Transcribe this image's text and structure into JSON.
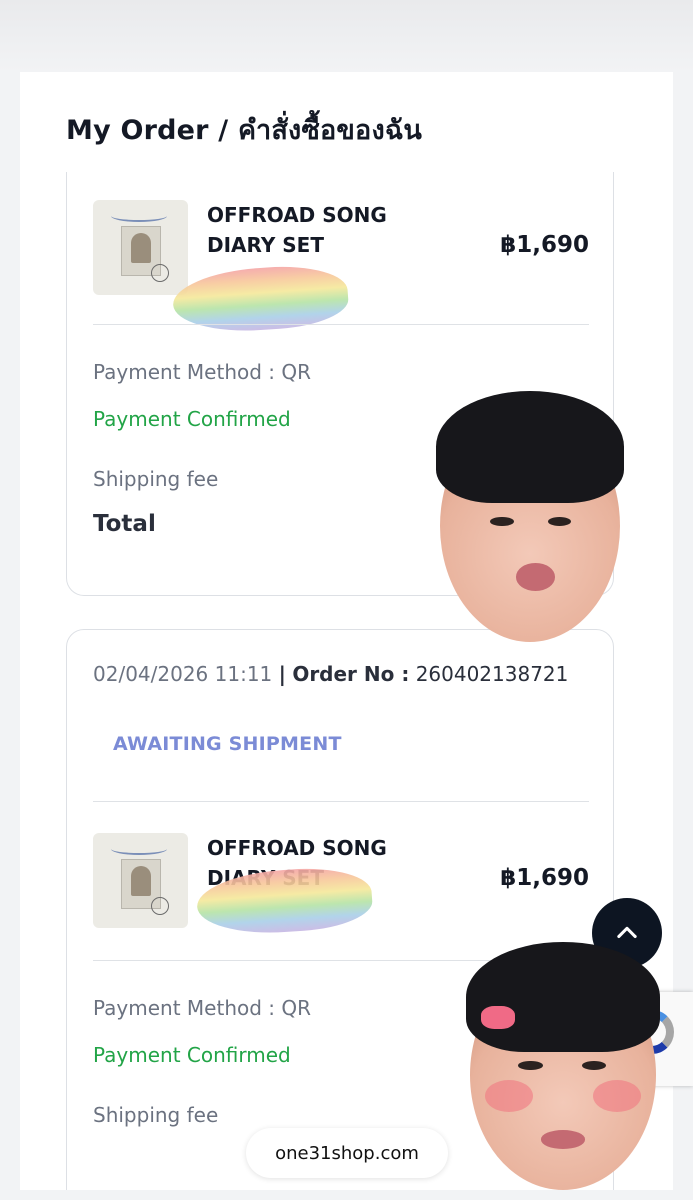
{
  "page": {
    "title": "My Order / คำสั่งซื้อของฉัน"
  },
  "orders": [
    {
      "product_name": "OFFROAD SONG DIARY SET",
      "price": "฿1,690",
      "payment_method": "Payment Method : QR",
      "payment_status": "Payment Confirmed",
      "shipping_fee_label": "Shipping fee",
      "total_label": "Total"
    },
    {
      "date_time": "02/04/2026 11:11",
      "separator": "|",
      "order_no_label": "Order No :",
      "order_no": "260402138721",
      "status": "AWAITING SHIPMENT",
      "product_name": "OFFROAD SONG DIARY SET",
      "price": "฿1,690",
      "payment_method": "Payment Method : QR",
      "payment_status": "Payment Confirmed",
      "shipping_fee_label": "Shipping fee"
    }
  ],
  "browser": {
    "url": "one31shop.com"
  },
  "icons": {
    "scroll_top": "chevron-up-icon",
    "recaptcha": "recaptcha-icon"
  },
  "colors": {
    "status_confirmed": "#22a447",
    "status_awaiting": "#7b8bd6",
    "scroll_button": "#0d1522"
  }
}
